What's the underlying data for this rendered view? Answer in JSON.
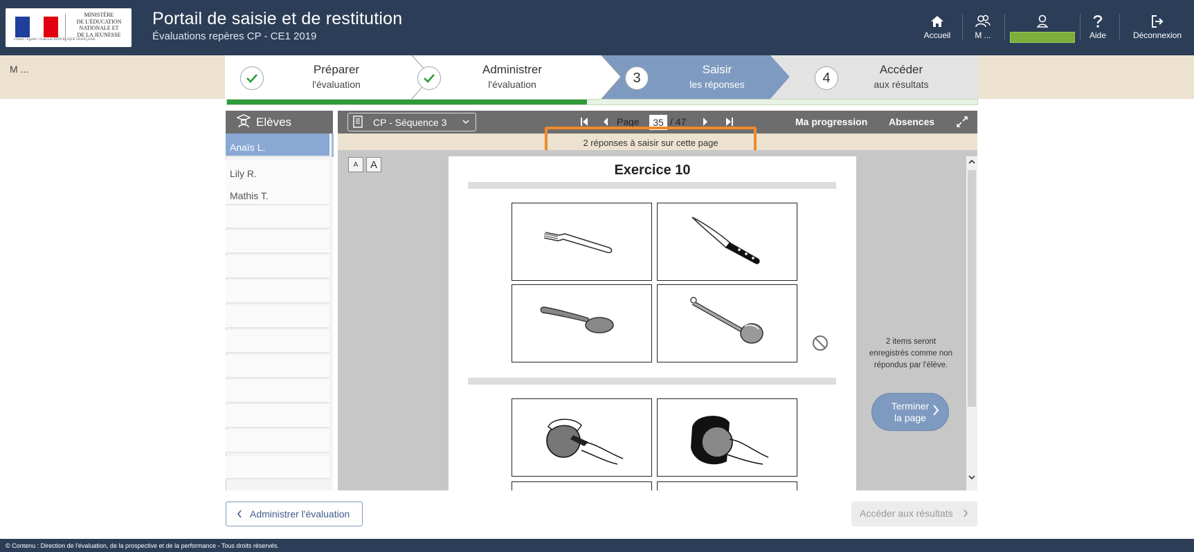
{
  "header": {
    "ministry_line1": "MINISTÈRE",
    "ministry_line2": "DE L'ÉDUCATION",
    "ministry_line3": "NATIONALE ET",
    "ministry_line4": "DE LA JEUNESSE",
    "motto": "Liberté • Égalité • Fraternité  RÉPUBLIQUE FRANÇAISE",
    "title": "Portail de saisie et de restitution",
    "subtitle": "Évaluations repères CP - CE1 2019",
    "nav": {
      "home": "Accueil",
      "users": "M ...",
      "help": "Aide",
      "logout": "Déconnexion"
    },
    "user_bar_color": "#7cae3b"
  },
  "band": {
    "name": "M ..."
  },
  "steps": [
    {
      "number": "✓",
      "line1": "Préparer",
      "line2": "l'évaluation",
      "state": "done"
    },
    {
      "number": "✓",
      "line1": "Administrer",
      "line2": "l'évaluation",
      "state": "done"
    },
    {
      "number": "3",
      "line1": "Saisir",
      "line2": "les réponses",
      "state": "active"
    },
    {
      "number": "4",
      "line1": "Accéder",
      "line2": "aux résultats",
      "state": "todo"
    }
  ],
  "progress": 0.48,
  "sidebar": {
    "title": "Elèves",
    "students": [
      "Anaïs L.",
      "Lily R.",
      "Mathis T."
    ],
    "selected": 0
  },
  "toolbar": {
    "sequence": "CP - Séquence 3",
    "page_label": "Page",
    "page_current": "35",
    "page_total": "/ 47",
    "progression": "Ma progression",
    "absences": "Absences"
  },
  "notice": "2 réponses à saisir sur cette page",
  "font_small": "A",
  "font_large": "A",
  "exercise": {
    "title": "Exercice 10"
  },
  "right_panel": {
    "info": "2 items seront enregistrés comme non répondus par l'élève.",
    "finish_line1": "Terminer",
    "finish_line2": "la page"
  },
  "buttons": {
    "prev": "Administrer l'évaluation",
    "next": "Accéder aux résultats"
  },
  "footer": "© Contenu : Direction de l'évaluation, de la prospective et de la performance - Tous droits réservés.",
  "colors": {
    "header_bg": "#2c3e57",
    "band_bg": "#ece2cf",
    "active_step": "#7f9ac0",
    "progress_green": "#2e9b3a",
    "highlight_orange": "#f08a2a",
    "selected_student": "#89a8d4"
  }
}
